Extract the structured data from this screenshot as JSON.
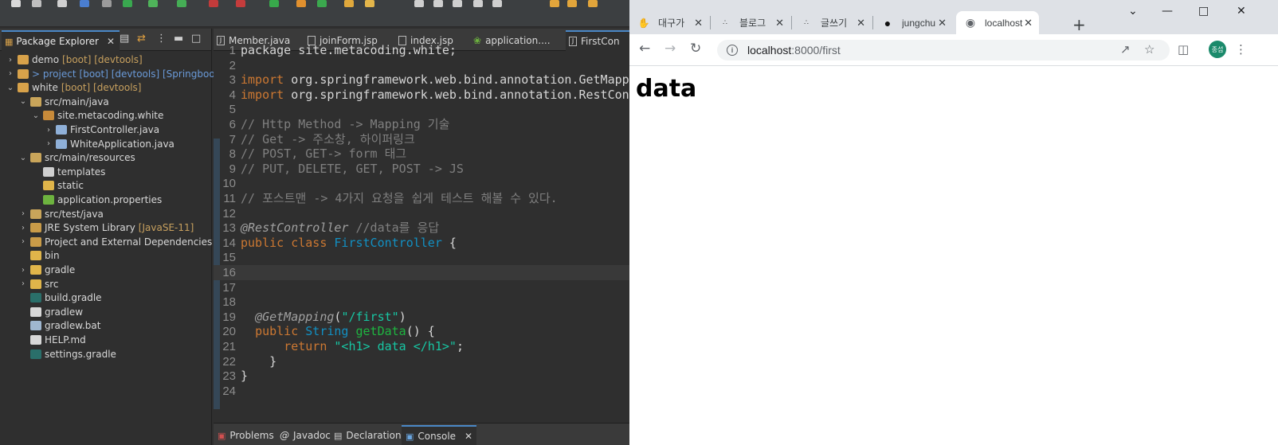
{
  "ide": {
    "package_explorer": {
      "title": "Package Explorer",
      "items": [
        {
          "label": "demo",
          "deco": "[boot] [devtools]"
        },
        {
          "label": "> project",
          "deco": "[boot] [devtools] [Springboot-JS"
        },
        {
          "label": "white",
          "deco": "[boot] [devtools]"
        },
        {
          "label": "src/main/java",
          "deco": ""
        },
        {
          "label": "site.metacoding.white",
          "deco": ""
        },
        {
          "label": "FirstController.java",
          "deco": ""
        },
        {
          "label": "WhiteApplication.java",
          "deco": ""
        },
        {
          "label": "src/main/resources",
          "deco": ""
        },
        {
          "label": "templates",
          "deco": ""
        },
        {
          "label": "static",
          "deco": ""
        },
        {
          "label": "application.properties",
          "deco": ""
        },
        {
          "label": "src/test/java",
          "deco": ""
        },
        {
          "label": "JRE System Library",
          "deco": "[JavaSE-11]"
        },
        {
          "label": "Project and External Dependencies",
          "deco": ""
        },
        {
          "label": "bin",
          "deco": ""
        },
        {
          "label": "gradle",
          "deco": ""
        },
        {
          "label": "src",
          "deco": ""
        },
        {
          "label": "build.gradle",
          "deco": ""
        },
        {
          "label": "gradlew",
          "deco": ""
        },
        {
          "label": "gradlew.bat",
          "deco": ""
        },
        {
          "label": "HELP.md",
          "deco": ""
        },
        {
          "label": "settings.gradle",
          "deco": ""
        }
      ]
    },
    "editor_tabs": [
      "Member.java",
      "joinForm.jsp",
      "index.jsp",
      "application....",
      "FirstCon"
    ],
    "code": {
      "l1": "package site.metacoding.white;",
      "l3a": "import ",
      "l3b": "org.springframework.web.bind.annotation.GetMapping;",
      "l4a": "import ",
      "l4b": "org.springframework.web.bind.annotation.RestController;",
      "l6": "// Http Method -> Mapping 기술",
      "l7": "// Get -> 주소창, 하이퍼링크",
      "l8": "// POST, GET-> form 태그",
      "l9": "// PUT, DELETE, GET, POST -> JS",
      "l11": "// 포스트맨 -> 4가지 요청을 쉽게 테스트 해볼 수 있다.",
      "l13a": "@RestController",
      "l13b": " //data를 응답",
      "l14a": "public class ",
      "l14b": "FirstController",
      "l14c": " {",
      "l19a": "@GetMapping",
      "l19b": "(",
      "l19c": "\"/first\"",
      "l19d": ")",
      "l20a": "public ",
      "l20b": "String ",
      "l20c": "getData",
      "l20d": "() {",
      "l21a": "return ",
      "l21b": "\"<h1> data </h1>\"",
      "l21c": ";",
      "l22": "}",
      "l23": "}"
    },
    "bottom_tabs": [
      "Problems",
      "Javadoc",
      "Declaration",
      "Console"
    ]
  },
  "browser": {
    "tabs": [
      {
        "title": "대구가",
        "icon": "hand-icon"
      },
      {
        "title": "블로그",
        "icon": "tistory-icon"
      },
      {
        "title": "글쓰기",
        "icon": "tistory-icon"
      },
      {
        "title": "jungchu",
        "icon": "github-icon"
      },
      {
        "title": "localhost",
        "icon": "globe-icon"
      }
    ],
    "url_host": "localhost",
    "url_path": ":8000/first",
    "avatar_text": "종섭",
    "page_heading": "data"
  }
}
